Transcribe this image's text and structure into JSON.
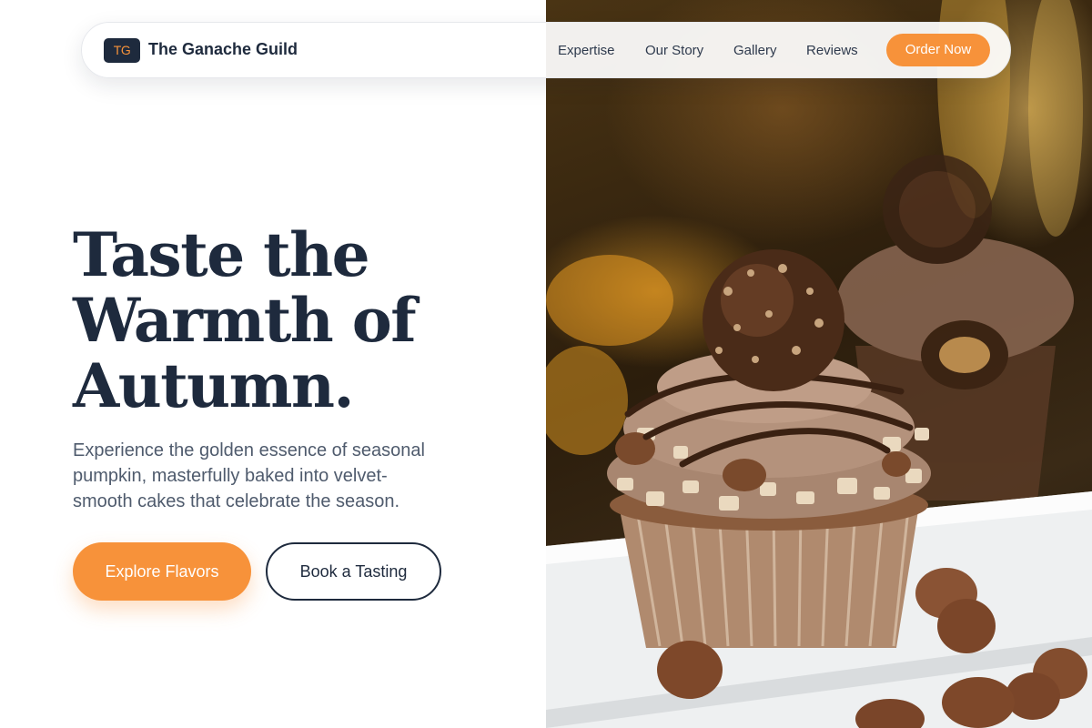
{
  "nav": {
    "logo_initials": "TG",
    "brand_name": "The Ganache Guild",
    "links": [
      {
        "label": "Expertise"
      },
      {
        "label": "Our Story"
      },
      {
        "label": "Gallery"
      },
      {
        "label": "Reviews"
      }
    ],
    "cta_label": "Order Now"
  },
  "hero": {
    "title_lines": [
      "Taste the",
      "Warmth of",
      "Autumn."
    ],
    "description_lines": [
      "Experience the golden essence of seasonal",
      "pumpkin, masterfully baked into velvet-",
      "smooth cakes that celebrate the season."
    ],
    "primary_button": "Explore Flavors",
    "secondary_button": "Book a Tasting"
  },
  "image": {
    "subject": "cupcake-photo"
  },
  "colors": {
    "accent": "#f7923a",
    "navy": "#1e2a3d",
    "body_text": "#4f5b6d"
  }
}
